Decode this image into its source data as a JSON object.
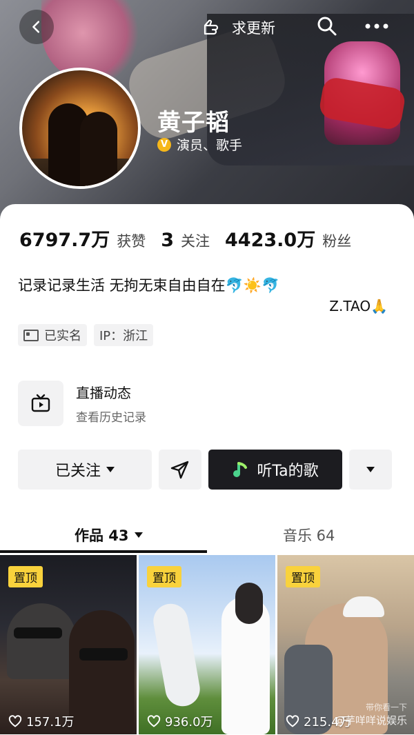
{
  "header": {
    "update_label": "求更新"
  },
  "profile": {
    "name": "黄子韬",
    "verify_badge": "V",
    "verify_text": "演员、歌手"
  },
  "stats": [
    {
      "num": "6797.7万",
      "label": "获赞"
    },
    {
      "num": "3",
      "label": "关注"
    },
    {
      "num": "4423.0万",
      "label": "粉丝"
    }
  ],
  "bio": {
    "line": "记录记录生活 无拘无束自由自在🐬☀️🐬",
    "signature": "Z.TAO🙏"
  },
  "tags": [
    {
      "label": "已实名",
      "icon": "id-card-icon"
    },
    {
      "label": "IP：浙江"
    }
  ],
  "live": {
    "title": "直播动态",
    "subtitle": "查看历史记录"
  },
  "actions": {
    "follow": "已关注",
    "music": "听Ta的歌"
  },
  "tabs": {
    "works": "作品 43",
    "music": "音乐 64"
  },
  "videos": [
    {
      "pin": "置顶",
      "likes": "157.1万"
    },
    {
      "pin": "置顶",
      "likes": "936.0万"
    },
    {
      "pin": "置顶",
      "likes": "215.4万"
    }
  ],
  "watermark": {
    "line1": "带你看一下",
    "line2": "@芋咩咩说娱乐"
  },
  "colors": {
    "accent_music_button": "#1c1c20",
    "pin_badge": "#f9d23c",
    "verify_badge": "#f6b71a"
  }
}
